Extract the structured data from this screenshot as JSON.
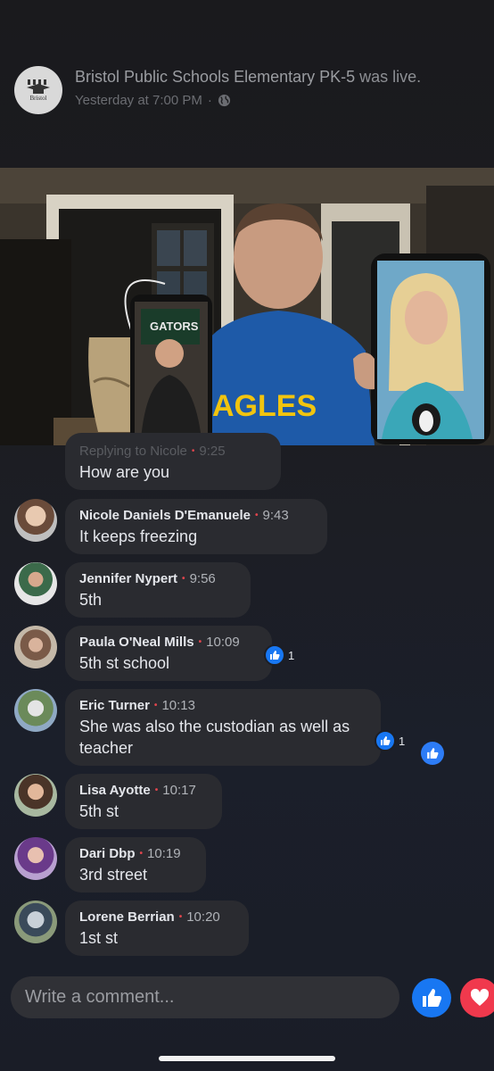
{
  "post": {
    "page_name": "Bristol Public Schools Elementary PK-5",
    "status": "was live.",
    "timestamp": "Yesterday at 7:00 PM",
    "separator": "·",
    "avatar_label": "Bristol",
    "privacy_icon": "globe-icon"
  },
  "video": {
    "phone_left_text": "GATORS",
    "shirt_text": "AGLES"
  },
  "partial_comment": {
    "reply_to": "Replying to Nicole",
    "time": "9:25",
    "text": "How are you"
  },
  "comments": [
    {
      "name": "Nicole Daniels D'Emanuele",
      "time": "9:43",
      "text": "It keeps freezing",
      "reactions": ""
    },
    {
      "name": "Jennifer Nypert",
      "time": "9:56",
      "text": "5th",
      "reactions": ""
    },
    {
      "name": "Paula O'Neal Mills",
      "time": "10:09",
      "text": "5th st school",
      "reactions": "1"
    },
    {
      "name": "Eric Turner",
      "time": "10:13",
      "text": "She was also the custodian as well as teacher",
      "reactions": "1"
    },
    {
      "name": "Lisa Ayotte",
      "time": "10:17",
      "text": "5th st",
      "reactions": ""
    },
    {
      "name": "Dari Dbp",
      "time": "10:19",
      "text": "3rd street",
      "reactions": ""
    },
    {
      "name": "Lorene Berrian",
      "time": "10:20",
      "text": "1st st",
      "reactions": ""
    }
  ],
  "composer": {
    "placeholder": "Write a comment..."
  },
  "colors": {
    "accent": "#1877f2",
    "love": "#f0394d",
    "live_dot": "#e0454d"
  }
}
